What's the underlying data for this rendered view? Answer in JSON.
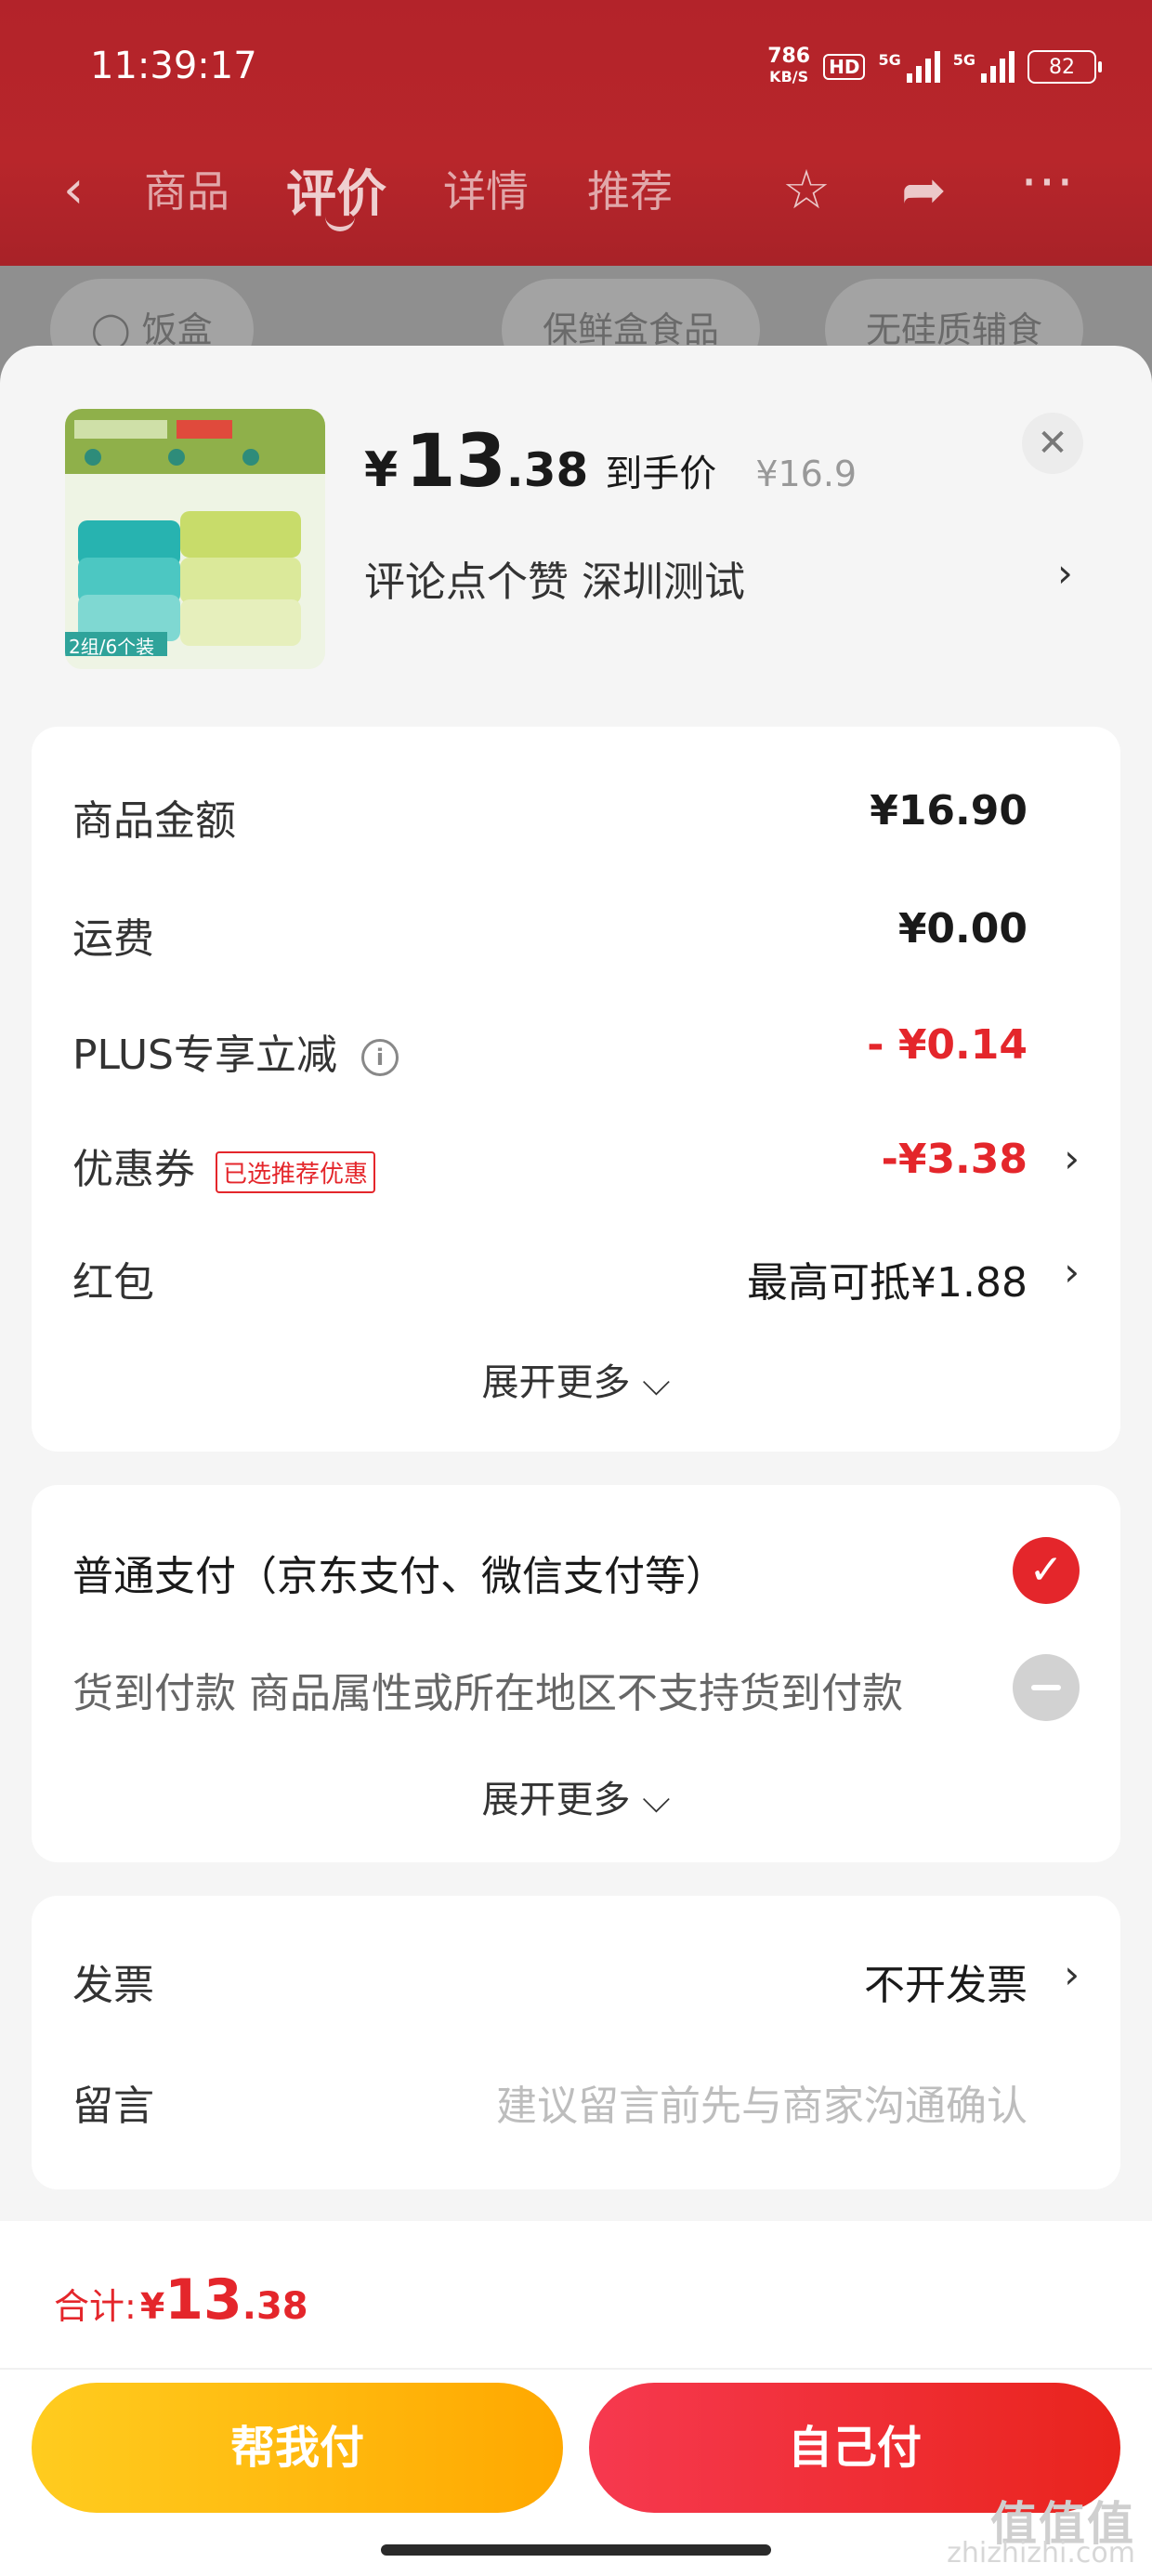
{
  "status_bar": {
    "time": "11:39:17",
    "net_speed_value": "786",
    "net_speed_unit": "KB/S",
    "hd_label": "HD",
    "signal1_label": "5G",
    "signal2_label": "5G",
    "battery": "82"
  },
  "nav": {
    "tabs": [
      {
        "label": "商品"
      },
      {
        "label": "评价"
      },
      {
        "label": "详情"
      },
      {
        "label": "推荐"
      }
    ],
    "active_tab": "评价",
    "icons": [
      "back-icon",
      "star-icon",
      "share-icon",
      "more-icon"
    ]
  },
  "background_chips": [
    "饭盒",
    "保鲜盒食品",
    "无硅质辅食"
  ],
  "product": {
    "price_yen": "¥",
    "price_int": "13",
    "price_dec": ".38",
    "price_label": "到手价",
    "original_price": "¥16.9",
    "spec_text": "评论点个赞  深圳测试",
    "image_label": "2组/6个装"
  },
  "cost_summary": {
    "rows": [
      {
        "label": "商品金额",
        "value": "¥16.90"
      },
      {
        "label": "运费",
        "value": "¥0.00"
      },
      {
        "label": "PLUS专享立减",
        "value": "- ¥0.14"
      },
      {
        "label": "优惠券",
        "tag": "已选推荐优惠",
        "value": "-¥3.38"
      },
      {
        "label": "红包",
        "value": "最高可抵¥1.88"
      }
    ],
    "expand_label": "展开更多"
  },
  "payment": {
    "options": [
      {
        "label": "普通支付（京东支付、微信支付等）",
        "selected": true
      },
      {
        "label": "货到付款 商品属性或所在地区不支持货到付款",
        "selected": false
      }
    ],
    "expand_label": "展开更多"
  },
  "extras": {
    "invoice_label": "发票",
    "invoice_value": "不开发票",
    "message_label": "留言",
    "message_placeholder": "建议留言前先与商家沟通确认"
  },
  "footer": {
    "total_label": "合计:",
    "total_yen": "¥",
    "total_int": "13",
    "total_dec": ".38",
    "help_pay": "帮我付",
    "self_pay": "自己付"
  },
  "watermark": {
    "line1": "值值值",
    "line2": "zhizhizhi.com"
  },
  "colors": {
    "accent_red": "#e4262b",
    "header_red": "#b3232a",
    "help_yellow": "#ffb800"
  }
}
